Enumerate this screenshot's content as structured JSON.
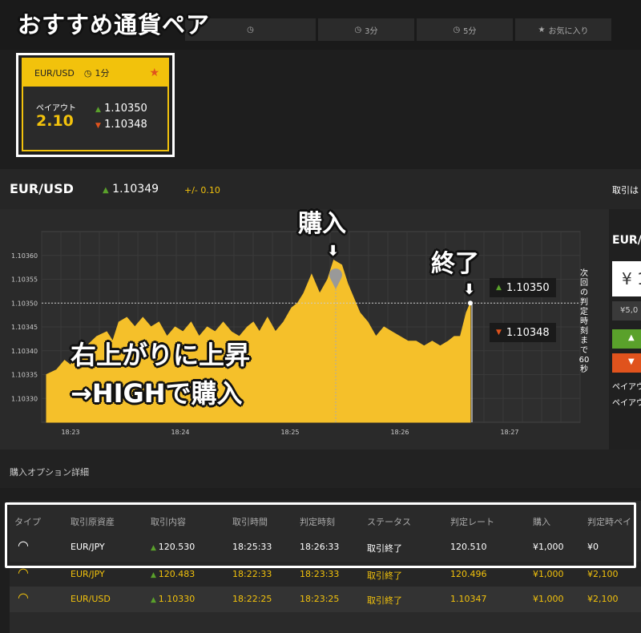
{
  "banner": "おすすめ通貨ペア",
  "tabs": [
    {
      "label": "3分",
      "icon": "clock-icon"
    },
    {
      "label": "5分",
      "icon": "clock-icon"
    },
    {
      "label": "お気に入り",
      "icon": "star-icon"
    }
  ],
  "card": {
    "pair": "EUR/USD",
    "duration": "1分",
    "payout_label": "ペイアウト",
    "payout": "2.10",
    "high_rate": "1.10350",
    "low_rate": "1.10348"
  },
  "pair_header": {
    "name": "EUR/USD",
    "rate": "1.10349",
    "change": "+/- 0.10",
    "trade_label": "取引は"
  },
  "right_panel": {
    "title": "EUR/",
    "amount": "¥ 1",
    "quick_amount": "¥5,0",
    "payout1": "ペイアウ",
    "payout2": "ペイアウ"
  },
  "chart_data": {
    "type": "area",
    "x_ticks": [
      "18:23",
      "18:24",
      "18:25",
      "18:26",
      "18:27"
    ],
    "y_ticks": [
      "1.10360",
      "1.10355",
      "1.10350",
      "1.10345",
      "1.10340",
      "1.10335",
      "1.10330"
    ],
    "ylim": [
      1.10325,
      1.10365
    ],
    "reference_line": 1.1035,
    "high_rate": "1.10350",
    "low_rate": "1.10348",
    "countdown": "次回の判定時刻まで60秒",
    "series": [
      {
        "values": [
          [
            0.0,
            1.10335
          ],
          [
            0.05,
            1.10336
          ],
          [
            0.09,
            1.10338
          ],
          [
            0.12,
            1.10337
          ],
          [
            0.15,
            1.10339
          ],
          [
            0.2,
            1.10341
          ],
          [
            0.25,
            1.10343
          ],
          [
            0.3,
            1.10344
          ],
          [
            0.33,
            1.10342
          ],
          [
            0.36,
            1.10346
          ],
          [
            0.4,
            1.10347
          ],
          [
            0.44,
            1.10345
          ],
          [
            0.48,
            1.10347
          ],
          [
            0.52,
            1.10345
          ],
          [
            0.56,
            1.10346
          ],
          [
            0.6,
            1.10343
          ],
          [
            0.64,
            1.10345
          ],
          [
            0.68,
            1.10344
          ],
          [
            0.72,
            1.10346
          ],
          [
            0.76,
            1.10343
          ],
          [
            0.8,
            1.10345
          ],
          [
            0.84,
            1.10344
          ],
          [
            0.88,
            1.10346
          ],
          [
            0.92,
            1.10344
          ],
          [
            0.96,
            1.10343
          ],
          [
            1.0,
            1.10345
          ],
          [
            1.03,
            1.10346
          ],
          [
            1.06,
            1.10344
          ],
          [
            1.1,
            1.10347
          ],
          [
            1.14,
            1.10344
          ],
          [
            1.18,
            1.10346
          ],
          [
            1.22,
            1.10349
          ],
          [
            1.25,
            1.1035
          ],
          [
            1.28,
            1.10352
          ],
          [
            1.32,
            1.10356
          ],
          [
            1.36,
            1.10352
          ],
          [
            1.4,
            1.10355
          ],
          [
            1.43,
            1.10359
          ],
          [
            1.47,
            1.10358
          ],
          [
            1.5,
            1.10354
          ],
          [
            1.53,
            1.10351
          ],
          [
            1.56,
            1.10348
          ],
          [
            1.6,
            1.10346
          ],
          [
            1.64,
            1.10343
          ],
          [
            1.68,
            1.10345
          ],
          [
            1.72,
            1.10344
          ],
          [
            1.76,
            1.10343
          ],
          [
            1.8,
            1.10342
          ],
          [
            1.84,
            1.10342
          ],
          [
            1.88,
            1.10341
          ],
          [
            1.92,
            1.10342
          ],
          [
            1.96,
            1.10341
          ],
          [
            2.0,
            1.10342
          ],
          [
            2.03,
            1.10343
          ],
          [
            2.06,
            1.10343
          ],
          [
            2.09,
            1.10348
          ],
          [
            2.11,
            1.1035
          ]
        ]
      }
    ]
  },
  "annotations": {
    "buy": "購入",
    "end": "終了",
    "line1": "右上がりに上昇",
    "line2": "→HIGHで購入"
  },
  "options": {
    "title": "購入オプション詳細",
    "headers": [
      "タイプ",
      "取引原資産",
      "取引内容",
      "取引時間",
      "判定時刻",
      "ステータス",
      "判定レート",
      "購入",
      "判定時ペイ"
    ],
    "rows": [
      {
        "pair": "EUR/JPY",
        "rate": "120.530",
        "time": "18:25:33",
        "judge": "18:26:33",
        "status": "取引終了",
        "judge_rate": "120.510",
        "amount": "¥1,000",
        "payout": "¥0",
        "style": "normal"
      },
      {
        "pair": "EUR/JPY",
        "rate": "120.483",
        "time": "18:22:33",
        "judge": "18:23:33",
        "status": "取引終了",
        "judge_rate": "120.496",
        "amount": "¥1,000",
        "payout": "¥2,100",
        "style": "win"
      },
      {
        "pair": "EUR/USD",
        "rate": "1.10330",
        "time": "18:22:25",
        "judge": "18:23:25",
        "status": "取引終了",
        "judge_rate": "1.10347",
        "amount": "¥1,000",
        "payout": "¥2,100",
        "style": "win"
      }
    ]
  },
  "colors": {
    "accent": "#f2c20c",
    "up": "#5aa12b",
    "down": "#e0531d"
  }
}
